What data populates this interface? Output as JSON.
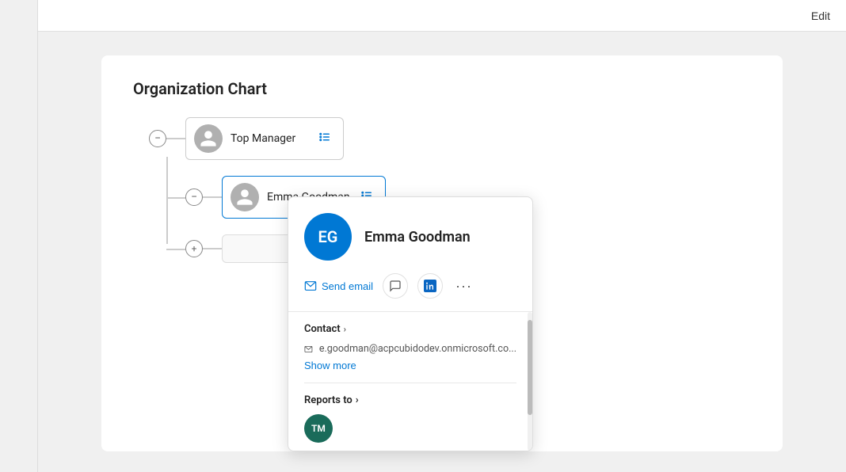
{
  "topbar": {
    "edit_label": "Edit"
  },
  "org_chart": {
    "title": "Organization Chart",
    "nodes": [
      {
        "id": "top-manager",
        "name": "Top Manager",
        "level": 0
      },
      {
        "id": "emma-goodman",
        "name": "Emma Goodman",
        "level": 1
      }
    ]
  },
  "popup": {
    "initials": "EG",
    "name": "Emma Goodman",
    "send_email_label": "Send email",
    "contact_section": "Contact",
    "email": "e.goodman@acpcubidodev.onmicrosoft.co...",
    "show_more_label": "Show more",
    "reports_to_section": "Reports to",
    "reports_to_initials": "TM",
    "ellipsis": "···"
  }
}
